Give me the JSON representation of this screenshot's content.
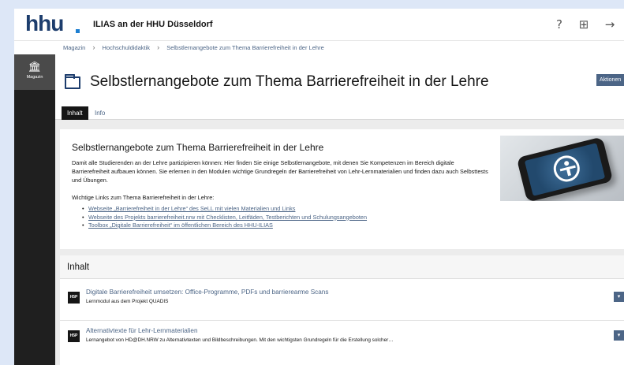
{
  "header": {
    "logo_text": "hhu",
    "site_title": "ILIAS an der HHU Düsseldorf",
    "icons": {
      "help": "help-icon",
      "notifications": "notification-icon",
      "logout": "logout-icon"
    }
  },
  "breadcrumb": [
    "Magazin",
    "Hochschuldidaktik",
    "Selbstlernangebote zum Thema Barrierefreiheit in der Lehre"
  ],
  "mainbar": {
    "item_label": "Magazin",
    "item_icon": "repository-icon"
  },
  "page": {
    "title": "Selbstlernangebote zum Thema Barrierefreiheit in der Lehre",
    "actions_label": "Aktionen"
  },
  "tabs": [
    {
      "label": "Inhalt",
      "active": true
    },
    {
      "label": "Info",
      "active": false
    }
  ],
  "intro": {
    "title": "Selbstlernangebote zum Thema Barrierefreiheit in der Lehre",
    "text": "Damit alle Studierenden an der Lehre partizipieren können: Hier finden Sie einige Selbstlernangebote, mit denen Sie Kompetenzen im Bereich digitale Barrierefreiheit aufbauen können. Sie erlernen in den Modulen wichtige Grundregeln der Barrierefreiheit von Lehr-Lernmaterialien und finden dazu auch Selbsttests und Übungen.",
    "links_heading": "Wichtige Links zum Thema Barrierefreiheit in der Lehre:",
    "links": [
      "Webseite „Barrierefreiheit in der Lehre“ des SeLL mit vielen Materialien und Links",
      "Webseite des Projekts barrierefreiheit.nrw mit Checklisten, Leitfäden, Testberichten und Schulungsangeboten",
      "Toolbox „Digitale Barrierefreiheit“ im öffentlichen Bereich des HHU-ILIAS"
    ]
  },
  "content_list": {
    "heading": "Inhalt",
    "items": [
      {
        "icon_label": "H5P",
        "title": "Digitale Barrierefreiheit umsetzen: Office-Programme, PDFs und barrierearme Scans",
        "description": "Lernmodul aus dem Projekt QUADIS"
      },
      {
        "icon_label": "H5P",
        "title": "Alternativtexte für Lehr-Lernmaterialien",
        "description": "Lernangebot von HD@DH.NRW zu Alternativtexten und Bildbeschreibungen. Mit den wichtigsten Grundregeln für die Erstellung solcher…"
      }
    ]
  },
  "colors": {
    "brand_navy": "#1d3d6d",
    "link": "#4c6586",
    "mainbar": "#1f1f1f",
    "background": "#ececec"
  }
}
